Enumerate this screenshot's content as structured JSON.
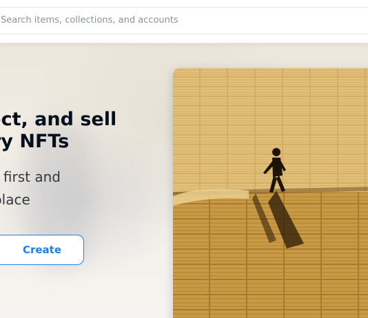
{
  "search": {
    "placeholder": "Search items, collections, and accounts"
  },
  "hero": {
    "headline_lines": [
      "Discover, collect, and sell",
      "extraordinary NFTs"
    ],
    "subtitle_lines": [
      "OpenSea is the world's first and",
      "largest NFT marketplace"
    ],
    "create_label": "Create"
  },
  "featured_art": {
    "description": "person walking on woven straw mats"
  },
  "colors": {
    "accent": "#2081e2",
    "headline": "#04111d",
    "body_text": "#353840",
    "placeholder": "#8a939b"
  }
}
